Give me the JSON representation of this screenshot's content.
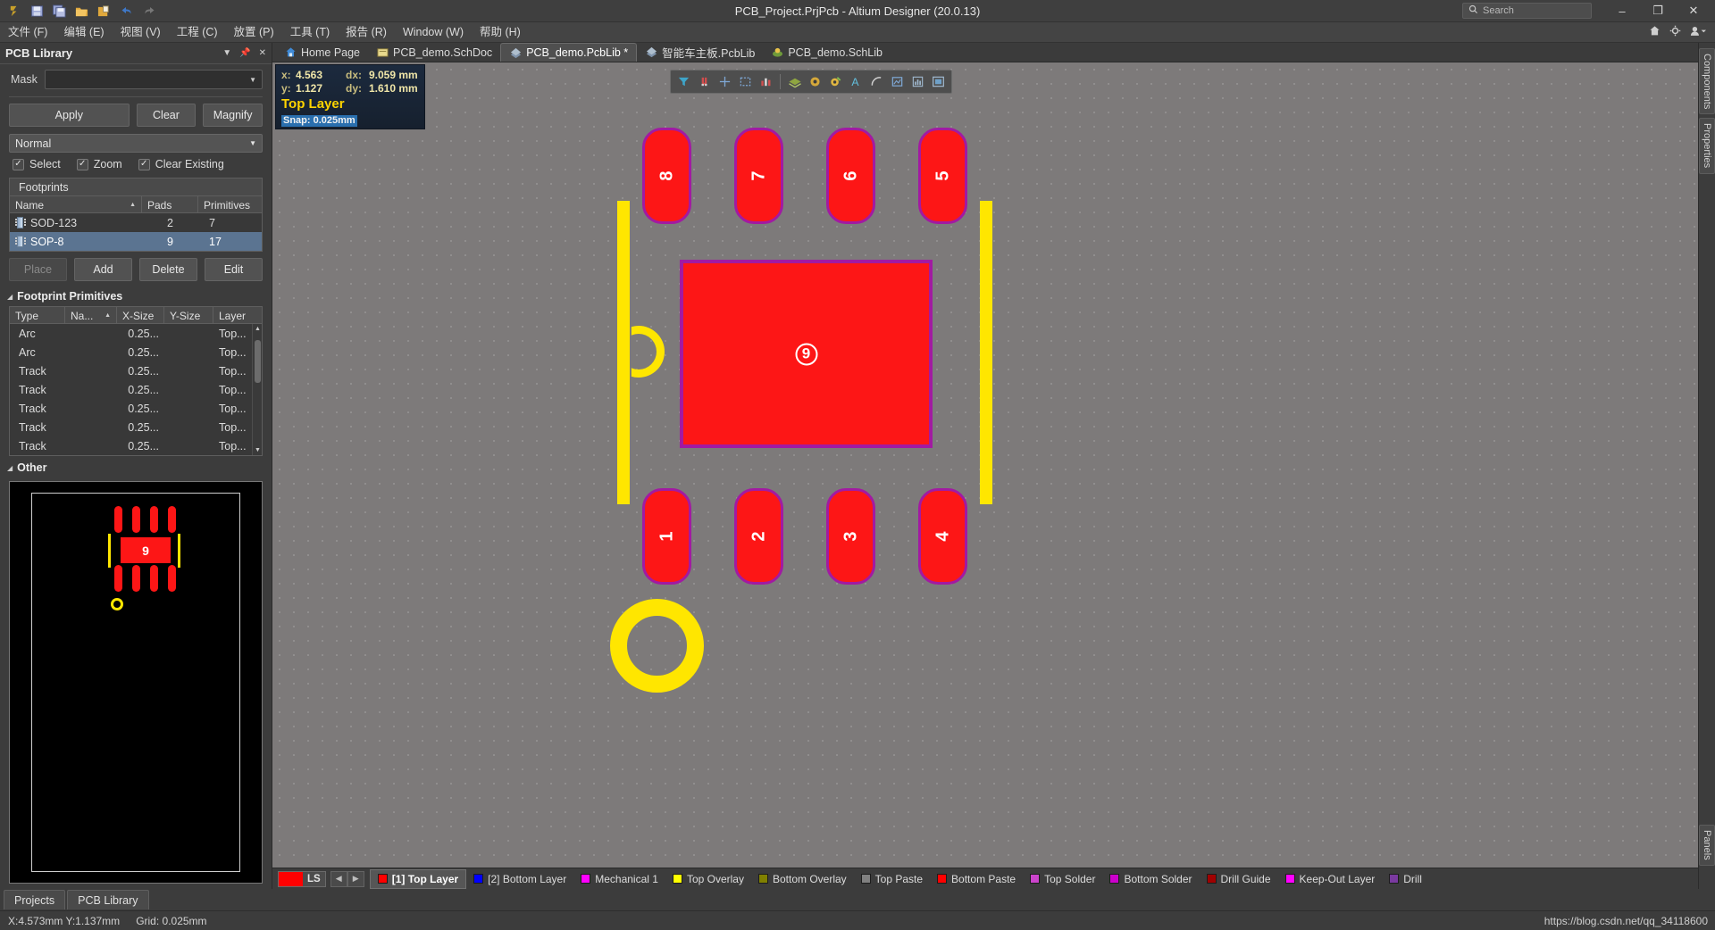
{
  "window": {
    "title": "PCB_Project.PrjPcb - Altium Designer (20.0.13)",
    "toolbar_icons": [
      "altium-logo-icon",
      "save-icon",
      "save-all-icon",
      "open-folder-icon",
      "open-project-icon",
      "undo-icon",
      "redo-icon"
    ],
    "search_placeholder": "Search",
    "minimize_label": "–",
    "maximize_label": "❐",
    "close_label": "✕"
  },
  "menu": {
    "items": [
      {
        "label": "文件 (F)"
      },
      {
        "label": "编辑 (E)"
      },
      {
        "label": "视图 (V)"
      },
      {
        "label": "工程 (C)"
      },
      {
        "label": "放置 (P)"
      },
      {
        "label": "工具 (T)"
      },
      {
        "label": "报告 (R)"
      },
      {
        "label": "Window (W)"
      },
      {
        "label": "帮助 (H)"
      }
    ],
    "right_icons": [
      "home-icon",
      "gear-icon",
      "user-dropdown-icon"
    ]
  },
  "panel": {
    "title": "PCB Library",
    "header_icons": [
      "chevron-down-icon",
      "pin-icon",
      "close-icon"
    ],
    "mask_label": "Mask",
    "mask_value": "",
    "buttons": {
      "apply": "Apply",
      "clear": "Clear",
      "magnify": "Magnify"
    },
    "normal_select": "Normal",
    "checkboxes": [
      {
        "label": "Select",
        "checked": true
      },
      {
        "label": "Zoom",
        "checked": true
      },
      {
        "label": "Clear Existing",
        "checked": true
      }
    ],
    "footprints": {
      "group_title": "Footprints",
      "columns": [
        "Name",
        "Pads",
        "Primitives"
      ],
      "sort_column": "Name",
      "rows": [
        {
          "name": "SOD-123",
          "pads": "2",
          "primitives": "7",
          "selected": false
        },
        {
          "name": "SOP-8",
          "pads": "9",
          "primitives": "17",
          "selected": true
        }
      ]
    },
    "fp_buttons": {
      "place": "Place",
      "add": "Add",
      "delete": "Delete",
      "edit": "Edit"
    },
    "primitives": {
      "section_title": "Footprint Primitives",
      "columns": [
        "Type",
        "Na...",
        "X-Size",
        "Y-Size",
        "Layer"
      ],
      "sort_column": "Na...",
      "rows": [
        {
          "type": "Arc",
          "name": "",
          "xsize": "0.25...",
          "ysize": "",
          "layer": "Top..."
        },
        {
          "type": "Arc",
          "name": "",
          "xsize": "0.25...",
          "ysize": "",
          "layer": "Top..."
        },
        {
          "type": "Track",
          "name": "",
          "xsize": "0.25...",
          "ysize": "",
          "layer": "Top..."
        },
        {
          "type": "Track",
          "name": "",
          "xsize": "0.25...",
          "ysize": "",
          "layer": "Top..."
        },
        {
          "type": "Track",
          "name": "",
          "xsize": "0.25...",
          "ysize": "",
          "layer": "Top..."
        },
        {
          "type": "Track",
          "name": "",
          "xsize": "0.25...",
          "ysize": "",
          "layer": "Top..."
        },
        {
          "type": "Track",
          "name": "",
          "xsize": "0.25...",
          "ysize": "",
          "layer": "Top..."
        }
      ]
    },
    "other": {
      "section_title": "Other"
    }
  },
  "tabs": [
    {
      "label": "Home Page",
      "icon": "home-icon",
      "active": false,
      "modified": false
    },
    {
      "label": "PCB_demo.SchDoc",
      "icon": "schematic-icon",
      "active": false,
      "modified": false
    },
    {
      "label": "PCB_demo.PcbLib *",
      "icon": "pcblib-icon",
      "active": true,
      "modified": true
    },
    {
      "label": "智能车主板.PcbLib",
      "icon": "pcblib-icon",
      "active": false,
      "modified": false
    },
    {
      "label": "PCB_demo.SchLib",
      "icon": "schlib-icon",
      "active": false,
      "modified": false
    }
  ],
  "infobox": {
    "x_key": "x:",
    "x_val": "4.563",
    "dx_key": "dx:",
    "dx_val": "9.059 mm",
    "y_key": "y:",
    "y_val": "1.127",
    "dy_key": "dy:",
    "dy_val": "1.610 mm",
    "layer": "Top Layer",
    "snap": "Snap: 0.025mm"
  },
  "canvas_toolbar": {
    "icons": [
      "filter-icon",
      "magnet-snap-icon",
      "crosshair-icon",
      "select-area-icon",
      "measure-icon",
      "layer-stack-icon",
      "via-icon",
      "pad-icon",
      "text-icon",
      "arc-icon",
      "polygon-icon",
      "chart-icon",
      "board-icon"
    ]
  },
  "pcb": {
    "footprint_name": "SOP-8",
    "top_pads": [
      {
        "number": "8"
      },
      {
        "number": "7"
      },
      {
        "number": "6"
      },
      {
        "number": "5"
      }
    ],
    "bottom_pads": [
      {
        "number": "1"
      },
      {
        "number": "2"
      },
      {
        "number": "3"
      },
      {
        "number": "4"
      }
    ],
    "center_pad": {
      "number": "9"
    },
    "pad_fill_color": "#fd1616",
    "pad_border_color": "#a21aa2",
    "silkscreen_color": "#ffe600"
  },
  "layerbar": {
    "ls_label": "LS",
    "ls_color": "#ff0000",
    "prev_label": "◀",
    "next_label": "▶",
    "layers": [
      {
        "label": "[1] Top Layer",
        "color": "#ff0000",
        "active": true
      },
      {
        "label": "[2] Bottom Layer",
        "color": "#0000ff",
        "active": false
      },
      {
        "label": "Mechanical 1",
        "color": "#ff00ff",
        "active": false
      },
      {
        "label": "Top Overlay",
        "color": "#ffff00",
        "active": false
      },
      {
        "label": "Bottom Overlay",
        "color": "#808000",
        "active": false
      },
      {
        "label": "Top Paste",
        "color": "#808080",
        "active": false
      },
      {
        "label": "Bottom Paste",
        "color": "#ff0000",
        "active": false
      },
      {
        "label": "Top Solder",
        "color": "#cc44cc",
        "active": false
      },
      {
        "label": "Bottom Solder",
        "color": "#cc00cc",
        "active": false
      },
      {
        "label": "Drill Guide",
        "color": "#a00000",
        "active": false
      },
      {
        "label": "Keep-Out Layer",
        "color": "#ff00ff",
        "active": false
      },
      {
        "label": "Drill",
        "color": "#7a3aa0",
        "active": false
      }
    ]
  },
  "bottom_tabs": [
    {
      "label": "Projects"
    },
    {
      "label": "PCB Library"
    }
  ],
  "statusbar": {
    "coords": "X:4.573mm Y:1.137mm",
    "grid": "Grid: 0.025mm",
    "watermark": "https://blog.csdn.net/qq_34118600"
  },
  "rightrail": {
    "items": [
      {
        "label": "Components"
      },
      {
        "label": "Properties"
      },
      {
        "label": "Panels"
      }
    ]
  }
}
